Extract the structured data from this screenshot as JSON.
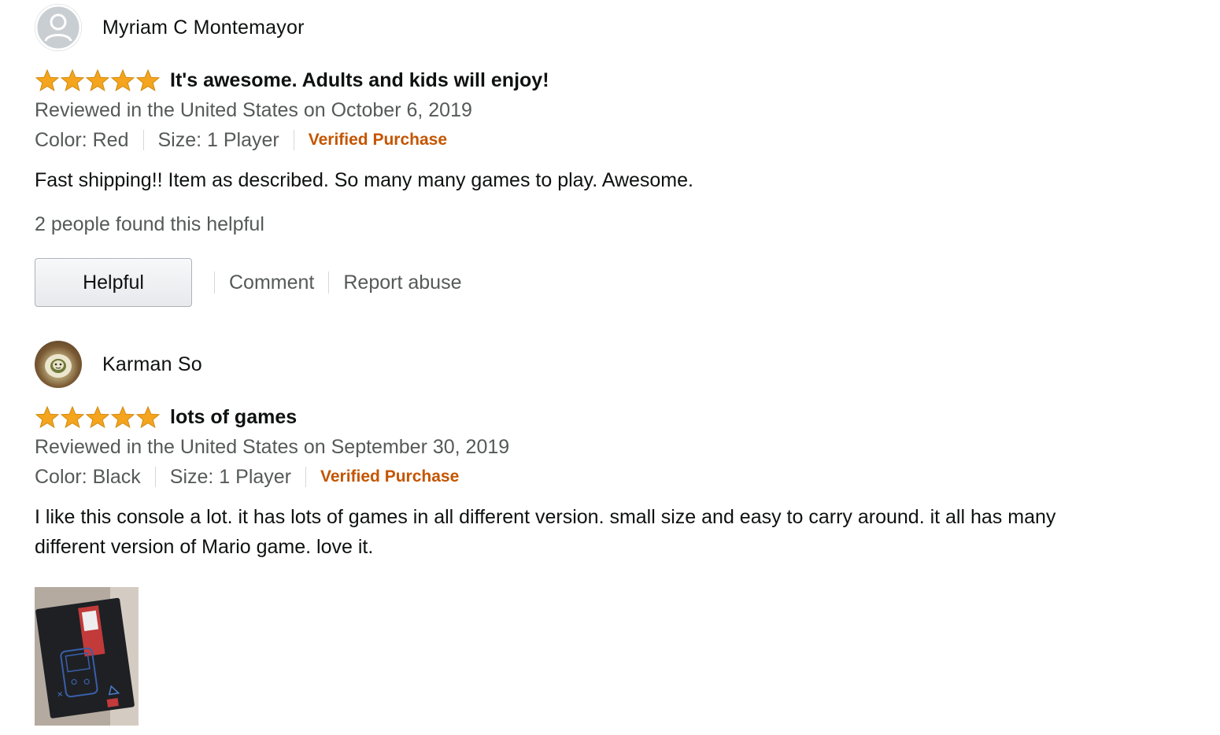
{
  "reviews": [
    {
      "author": "Myriam C Montemayor",
      "avatar_icon": "default-avatar-icon",
      "rating": 5,
      "title": "It's awesome. Adults and kids will enjoy!",
      "date": "Reviewed in the United States on October 6, 2019",
      "color": "Color: Red",
      "size": "Size: 1 Player",
      "verified": "Verified Purchase",
      "body": "Fast shipping!! Item as described. So many many games to play. Awesome.",
      "helpful_count": "2 people found this helpful",
      "helpful_label": "Helpful",
      "comment_label": "Comment",
      "report_label": "Report abuse"
    },
    {
      "author": "Karman So",
      "avatar_icon": "profile-photo",
      "rating": 5,
      "title": "lots of games",
      "date": "Reviewed in the United States on September 30, 2019",
      "color": "Color: Black",
      "size": "Size: 1 Player",
      "verified": "Verified Purchase",
      "body": "I like this console a lot. it has lots of games in all different version. small size and easy to carry around. it all has many different version of Mario game. love it.",
      "image_icon": "review-photo-console-box"
    }
  ],
  "colors": {
    "star": "#f4a41d",
    "star_stroke": "#d08a10",
    "verified": "#c45500",
    "secondary_text": "#565959"
  }
}
